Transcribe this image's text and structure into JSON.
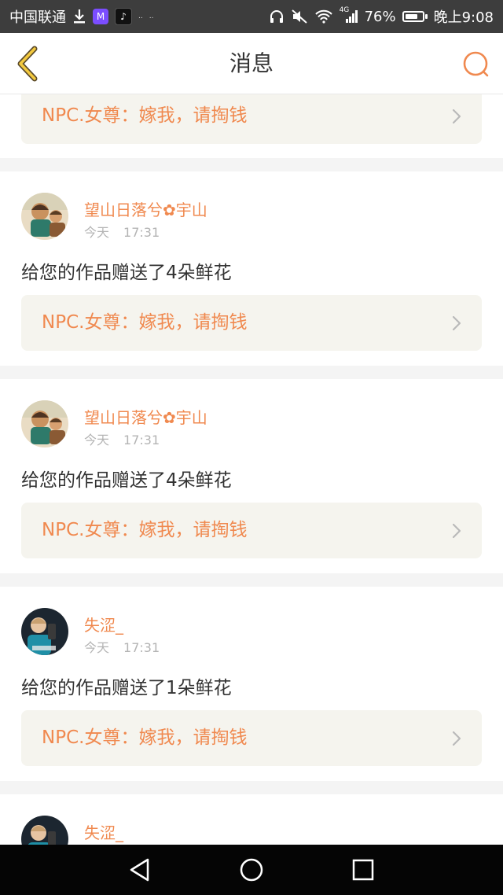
{
  "status_bar": {
    "carrier": "中国联通",
    "app_icons": [
      {
        "name": "download-icon",
        "glyph": "⬇"
      },
      {
        "name": "m-app-icon",
        "glyph": "M",
        "color": "#7b4dff"
      },
      {
        "name": "tiktok-icon",
        "glyph": "♪",
        "color": "#111111"
      }
    ],
    "small_labels": [
      "..",
      ".."
    ],
    "network": "4G",
    "battery_text": "76%",
    "battery_level": 0.76,
    "time": "晚上9:08"
  },
  "header": {
    "title": "消息"
  },
  "colors": {
    "accent": "#f0894f",
    "work_box_bg": "#f5f4ee",
    "page_bg": "#f4f4f4"
  },
  "top_partial_card": {
    "work_title": "NPC.女尊：嫁我，请掏钱"
  },
  "messages": [
    {
      "username": "望山日落兮✿宇山",
      "day": "今天",
      "time": "17:31",
      "text": "给您的作品赠送了4朵鲜花",
      "work_title": "NPC.女尊：嫁我，请掏钱",
      "avatar": "avatar-cartoon"
    },
    {
      "username": "望山日落兮✿宇山",
      "day": "今天",
      "time": "17:31",
      "text": "给您的作品赠送了4朵鲜花",
      "work_title": "NPC.女尊：嫁我，请掏钱",
      "avatar": "avatar-cartoon"
    },
    {
      "username": "失涩_",
      "day": "今天",
      "time": "17:31",
      "text": "给您的作品赠送了1朵鲜花",
      "work_title": "NPC.女尊：嫁我，请掏钱",
      "avatar": "avatar-photo"
    },
    {
      "username": "失涩_",
      "avatar": "avatar-photo"
    }
  ]
}
